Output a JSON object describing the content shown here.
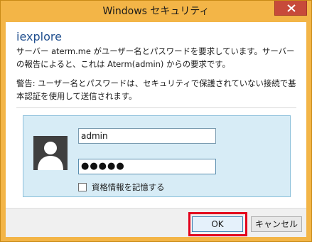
{
  "window": {
    "title": "Windows セキュリティ"
  },
  "colors": {
    "titlebar": "#f3b547",
    "close": "#c74a3a",
    "app_name": "#1f4e8e",
    "panel": "#d7ecf6",
    "highlight": "#e3001b"
  },
  "dialog": {
    "app_name": "iexplore",
    "message": "サーバー aterm.me がユーザー名とパスワードを要求しています。サーバーの報告によると、これは Aterm(admin) からの要求です。",
    "warning": "警告: ユーザー名とパスワードは、セキュリティで保護されていない接続で基本認証を使用して送信されます。"
  },
  "credentials": {
    "avatar_icon": "user-silhouette-icon",
    "username": "admin",
    "password_mask": "●●●●●",
    "remember_label": "資格情報を記憶する",
    "remember_checked": false
  },
  "buttons": {
    "ok": "OK",
    "cancel": "キャンセル"
  }
}
